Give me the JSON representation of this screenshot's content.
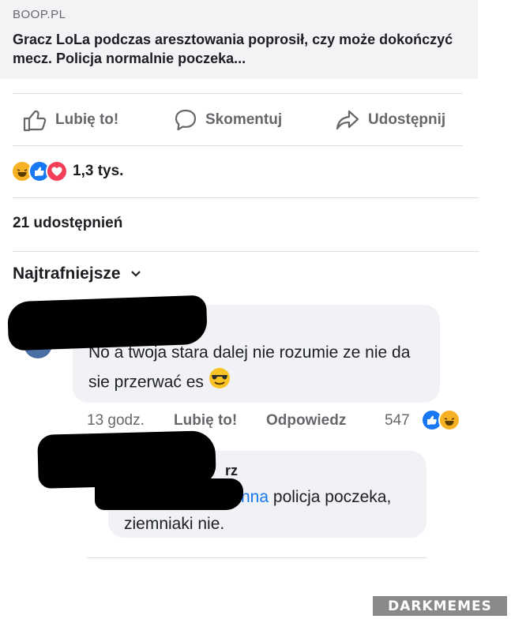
{
  "link_preview": {
    "source": "BOOP.PL",
    "title": "Gracz LoLa podczas aresztowania poprosił, czy może dokończyć mecz. Policja normalnie poczeka..."
  },
  "actions": {
    "like_label": "Lubię to!",
    "comment_label": "Skomentuj",
    "share_label": "Udostępnij"
  },
  "reactions": {
    "count": "1,3 tys.",
    "types": [
      "haha-icon",
      "like-icon",
      "love-icon"
    ]
  },
  "shares": {
    "label": "21 udostępnień"
  },
  "sort": {
    "label": "Najtrafniejsze"
  },
  "comments": [
    {
      "text": "No a twoja stara dalej nie rozumie ze nie da sie przerwać es",
      "emoji": "smiling-face-with-sunglasses",
      "time": "13 godz.",
      "like_label": "Lubię to!",
      "reply_label": "Odpowiedz",
      "reaction_count": "547"
    },
    {
      "name_fragment": "rz",
      "mention_fragment": "nna",
      "text": "policja poczeka, ziemniaki nie."
    }
  ],
  "watermark": "DARKMEMES",
  "colors": {
    "accent": "#1877f2",
    "muted": "#65676b",
    "bubble": "#f0f2f5",
    "haha": "#f7b125",
    "love": "#f33e58"
  }
}
